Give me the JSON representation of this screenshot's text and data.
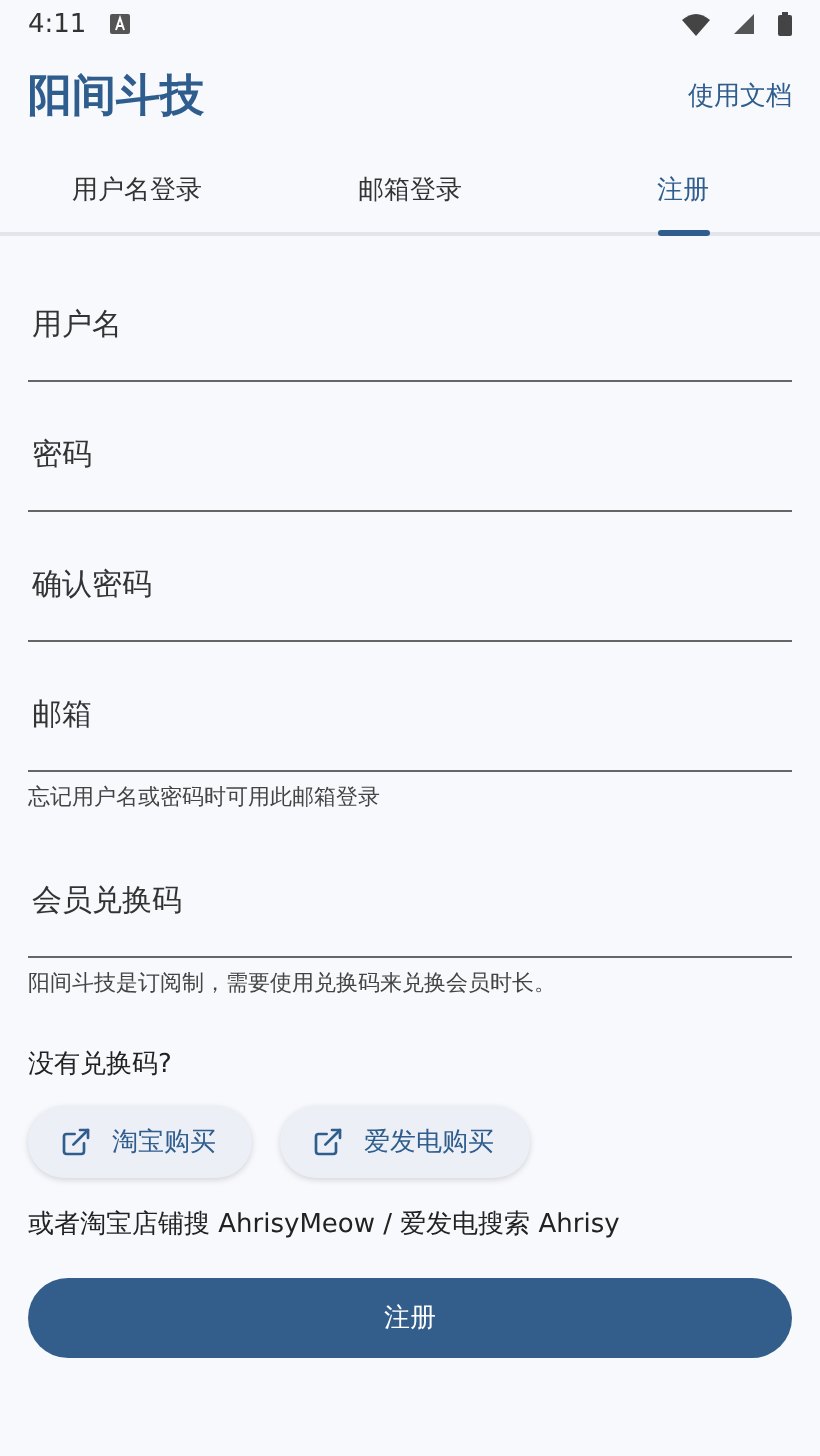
{
  "status_bar": {
    "time": "4:11"
  },
  "header": {
    "title": "阳间斗技",
    "link": "使用文档"
  },
  "tabs": [
    {
      "label": "用户名登录",
      "selected": false
    },
    {
      "label": "邮箱登录",
      "selected": false
    },
    {
      "label": "注册",
      "selected": true
    }
  ],
  "fields": [
    {
      "placeholder": "用户名"
    },
    {
      "placeholder": "密码"
    },
    {
      "placeholder": "确认密码"
    },
    {
      "placeholder": "邮箱",
      "helper": "忘记用户名或密码时可用此邮箱登录"
    },
    {
      "placeholder": "会员兑换码",
      "helper": "阳间斗技是订阅制，需要使用兑换码来兑换会员时长。"
    }
  ],
  "purchase": {
    "question": "没有兑换码?",
    "buttons": [
      "淘宝购买",
      "爱发电购买"
    ],
    "note": "或者淘宝店铺搜 AhrisyMeow / 爱发电搜索 Ahrisy"
  },
  "submit": "注册"
}
